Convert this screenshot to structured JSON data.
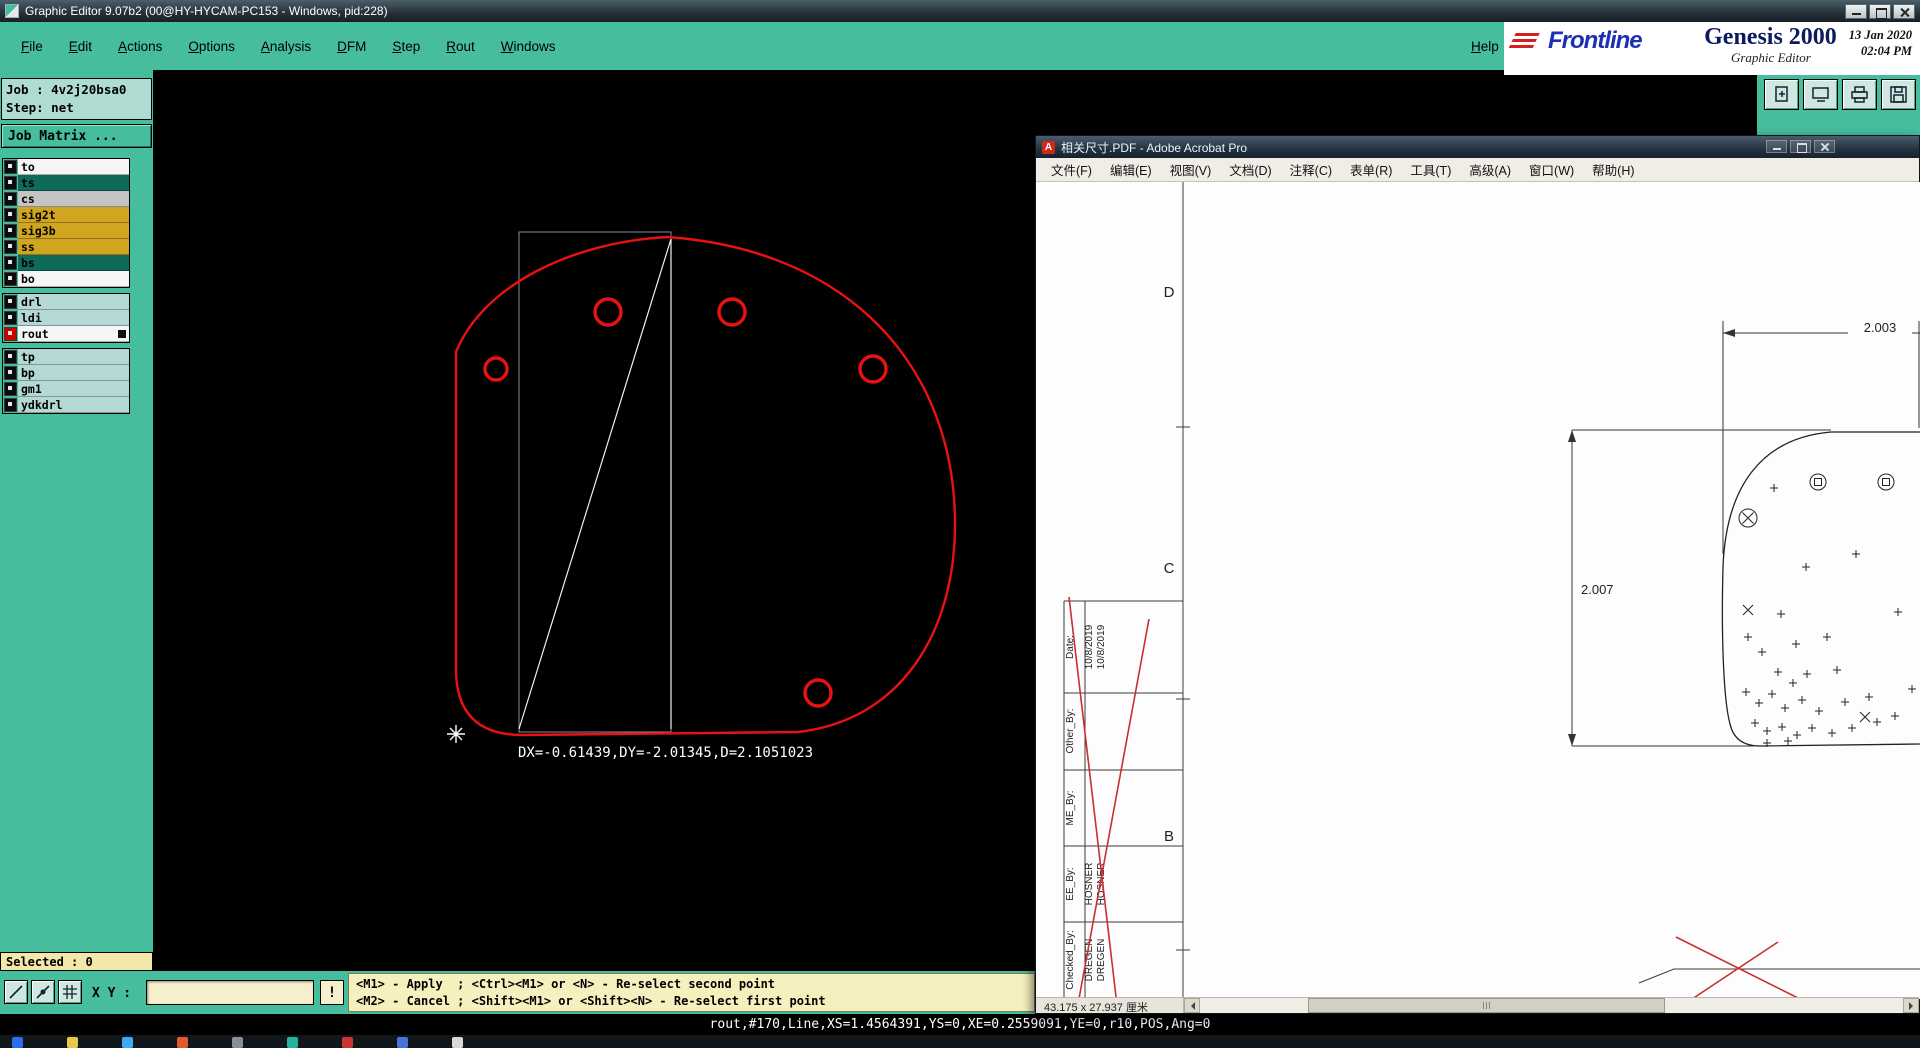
{
  "genesis": {
    "title": "Graphic Editor 9.07b2 (00@HY-HYCAM-PC153 - Windows, pid:228)",
    "menu": [
      "File",
      "Edit",
      "Actions",
      "Options",
      "Analysis",
      "DFM",
      "Step",
      "Rout",
      "Windows"
    ],
    "help_label": "Help",
    "brand": {
      "logo": "Frontline",
      "product": "Genesis 2000",
      "app": "Graphic Editor",
      "date": "13 Jan 2020",
      "time": "02:04 PM"
    },
    "job_label": "Job : 4v2j20bsa0",
    "step_label": "Step: net",
    "job_matrix_label": "Job Matrix ...",
    "layers": [
      {
        "name": "to",
        "bg": "#f5f5f5"
      },
      {
        "name": "ts",
        "bg": "#0e6a5b"
      },
      {
        "name": "cs",
        "bg": "#c4c4c4"
      },
      {
        "name": "sig2t",
        "bg": "#d0a51f"
      },
      {
        "name": "sig3b",
        "bg": "#d0a51f"
      },
      {
        "name": "ss",
        "bg": "#d0a51f"
      },
      {
        "name": "bs",
        "bg": "#0e6a5b"
      },
      {
        "name": "bo",
        "bg": "#f5f5f5"
      },
      {
        "name": "drl",
        "bg": "#b4d8d4"
      },
      {
        "name": "ldi",
        "bg": "#b4d8d4"
      },
      {
        "name": "rout",
        "bg": "#f5f5f5"
      },
      {
        "name": "tp",
        "bg": "#b4d8d4"
      },
      {
        "name": "bp",
        "bg": "#b4d8d4"
      },
      {
        "name": "gm1",
        "bg": "#b4d8d4"
      },
      {
        "name": "ydkdrl",
        "bg": "#b4d8d4"
      }
    ],
    "canvas": {
      "measure_text": "DX=-0.61439,DY=-2.01345,D=2.1051023",
      "outline_color": "#e81212"
    },
    "selected_label": "Selected : 0",
    "xy_label": "X Y :",
    "xy_value": "",
    "prompt_button": "!",
    "messages": [
      "<M1> - Apply  ; <Ctrl><M1> or <N> - Re-select second point",
      "<M2> - Cancel ; <Shift><M1> or <Shift><N> - Re-select first point"
    ],
    "status": "rout,#170,Line,XS=1.4564391,YS=0,XE=0.2559091,YE=0,r10,POS,Ang=0"
  },
  "acrobat": {
    "title": "相关尺寸.PDF - Adobe Acrobat Pro",
    "menu": [
      "文件(F)",
      "编辑(E)",
      "视图(V)",
      "文档(D)",
      "注释(C)",
      "表单(R)",
      "工具(T)",
      "高级(A)",
      "窗口(W)",
      "帮助(H)"
    ],
    "page_size": "43.175 x 27.937 厘米",
    "drawing": {
      "dim_width": "2.003",
      "dim_height": "2.007",
      "zone_labels": [
        "D",
        "C",
        "B"
      ],
      "title_block": {
        "date_label": "Date:",
        "date_values": [
          "10/8/2019",
          "10/8/2019"
        ],
        "other_by_label": "Other_By:",
        "me_by_label": "ME_By:",
        "ee_by_label": "EE_By:",
        "ee_by_values": [
          "HOSNER",
          "HOSNER"
        ],
        "checked_by_label": "Checked_By:",
        "checked_by_values": [
          "DREGEN",
          "DREGEN"
        ]
      }
    }
  }
}
